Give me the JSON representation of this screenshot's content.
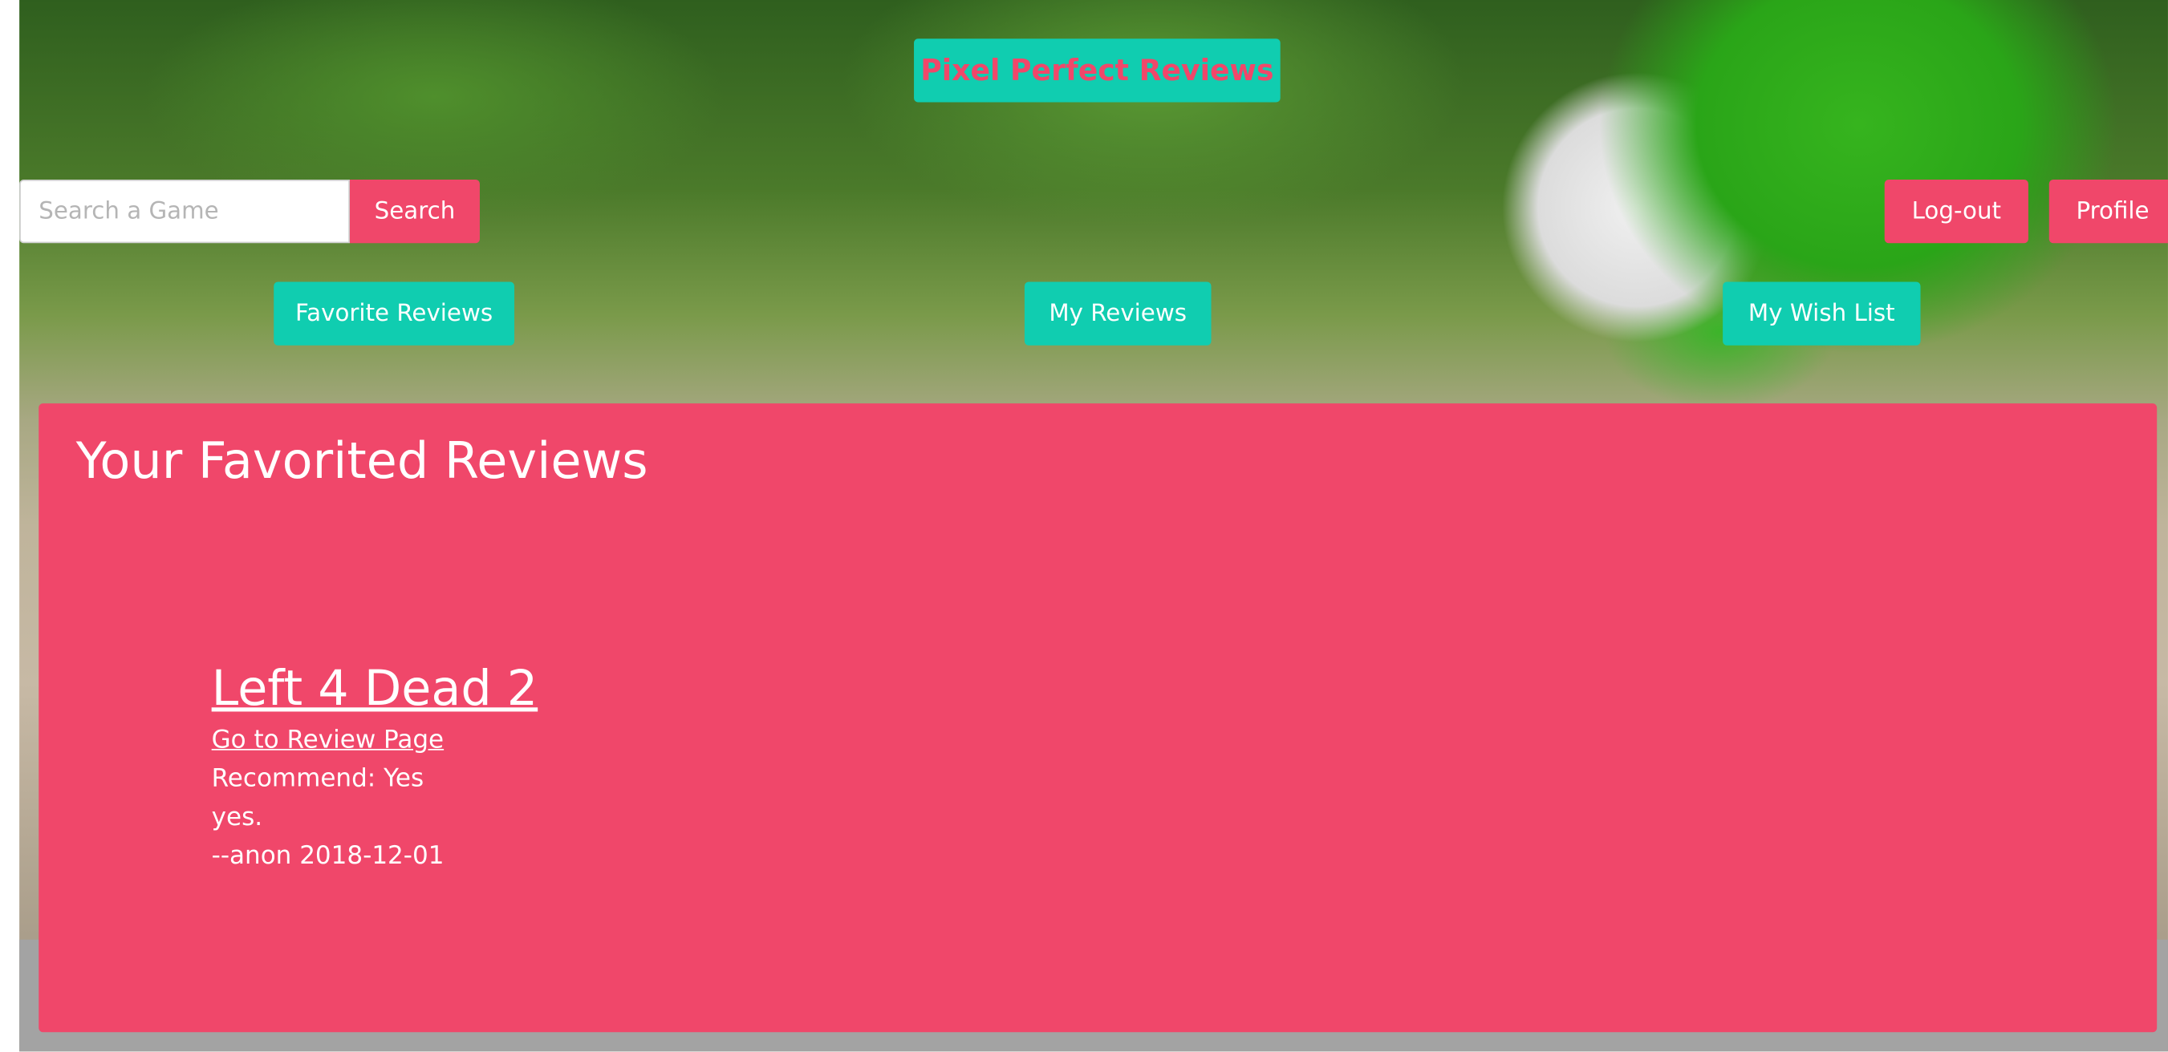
{
  "header": {
    "brand_label": "Pixel Perfect Reviews"
  },
  "search": {
    "placeholder": "Search a Game",
    "value": "",
    "button_label": "Search"
  },
  "account": {
    "logout_label": "Log-out",
    "profile_label": "Profile"
  },
  "nav": {
    "favorite_reviews_label": "Favorite Reviews",
    "my_reviews_label": "My Reviews",
    "my_wish_list_label": "My Wish List"
  },
  "main": {
    "title": "Your Favorited Reviews",
    "reviews": [
      {
        "game": "Left 4 Dead 2",
        "link_label": "Go to Review Page",
        "recommend": "Recommend: Yes",
        "body": "yes.",
        "byline": "--anon 2018-12-01"
      }
    ]
  },
  "colors": {
    "accent_pink": "#f0476a",
    "accent_teal": "#10cdb0"
  },
  "icons": {
    "background_image": "toy-figure-background"
  }
}
